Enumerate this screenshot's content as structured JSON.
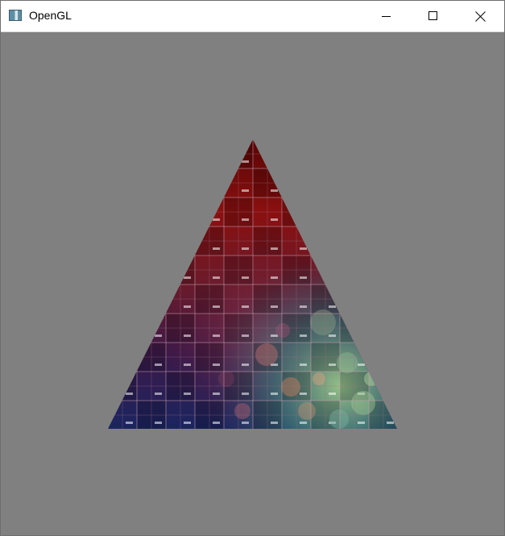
{
  "window": {
    "title": "OpenGL",
    "icons": {
      "app": "app-window-icon",
      "minimize": "minimize-icon",
      "maximize": "maximize-icon",
      "close": "close-icon"
    }
  },
  "viewport": {
    "clear_color": "#808080",
    "shape": "textured-triangle",
    "texture_palette": [
      "#8a1010",
      "#5a0a0a",
      "#6a1a3a",
      "#2a1a4a",
      "#1a2a6a",
      "#2a6a6a",
      "#8ab07a"
    ]
  }
}
